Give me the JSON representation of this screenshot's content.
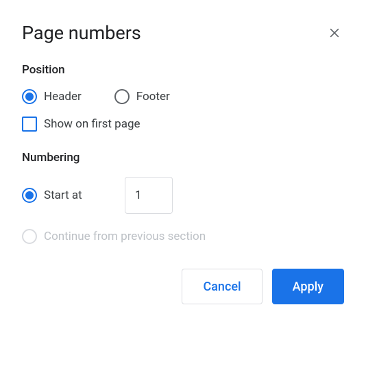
{
  "dialog": {
    "title": "Page numbers"
  },
  "position": {
    "label": "Position",
    "header_label": "Header",
    "footer_label": "Footer",
    "show_first_page_label": "Show on first page"
  },
  "numbering": {
    "label": "Numbering",
    "start_at_label": "Start at",
    "start_at_value": "1",
    "continue_label": "Continue from previous section"
  },
  "buttons": {
    "cancel": "Cancel",
    "apply": "Apply"
  }
}
